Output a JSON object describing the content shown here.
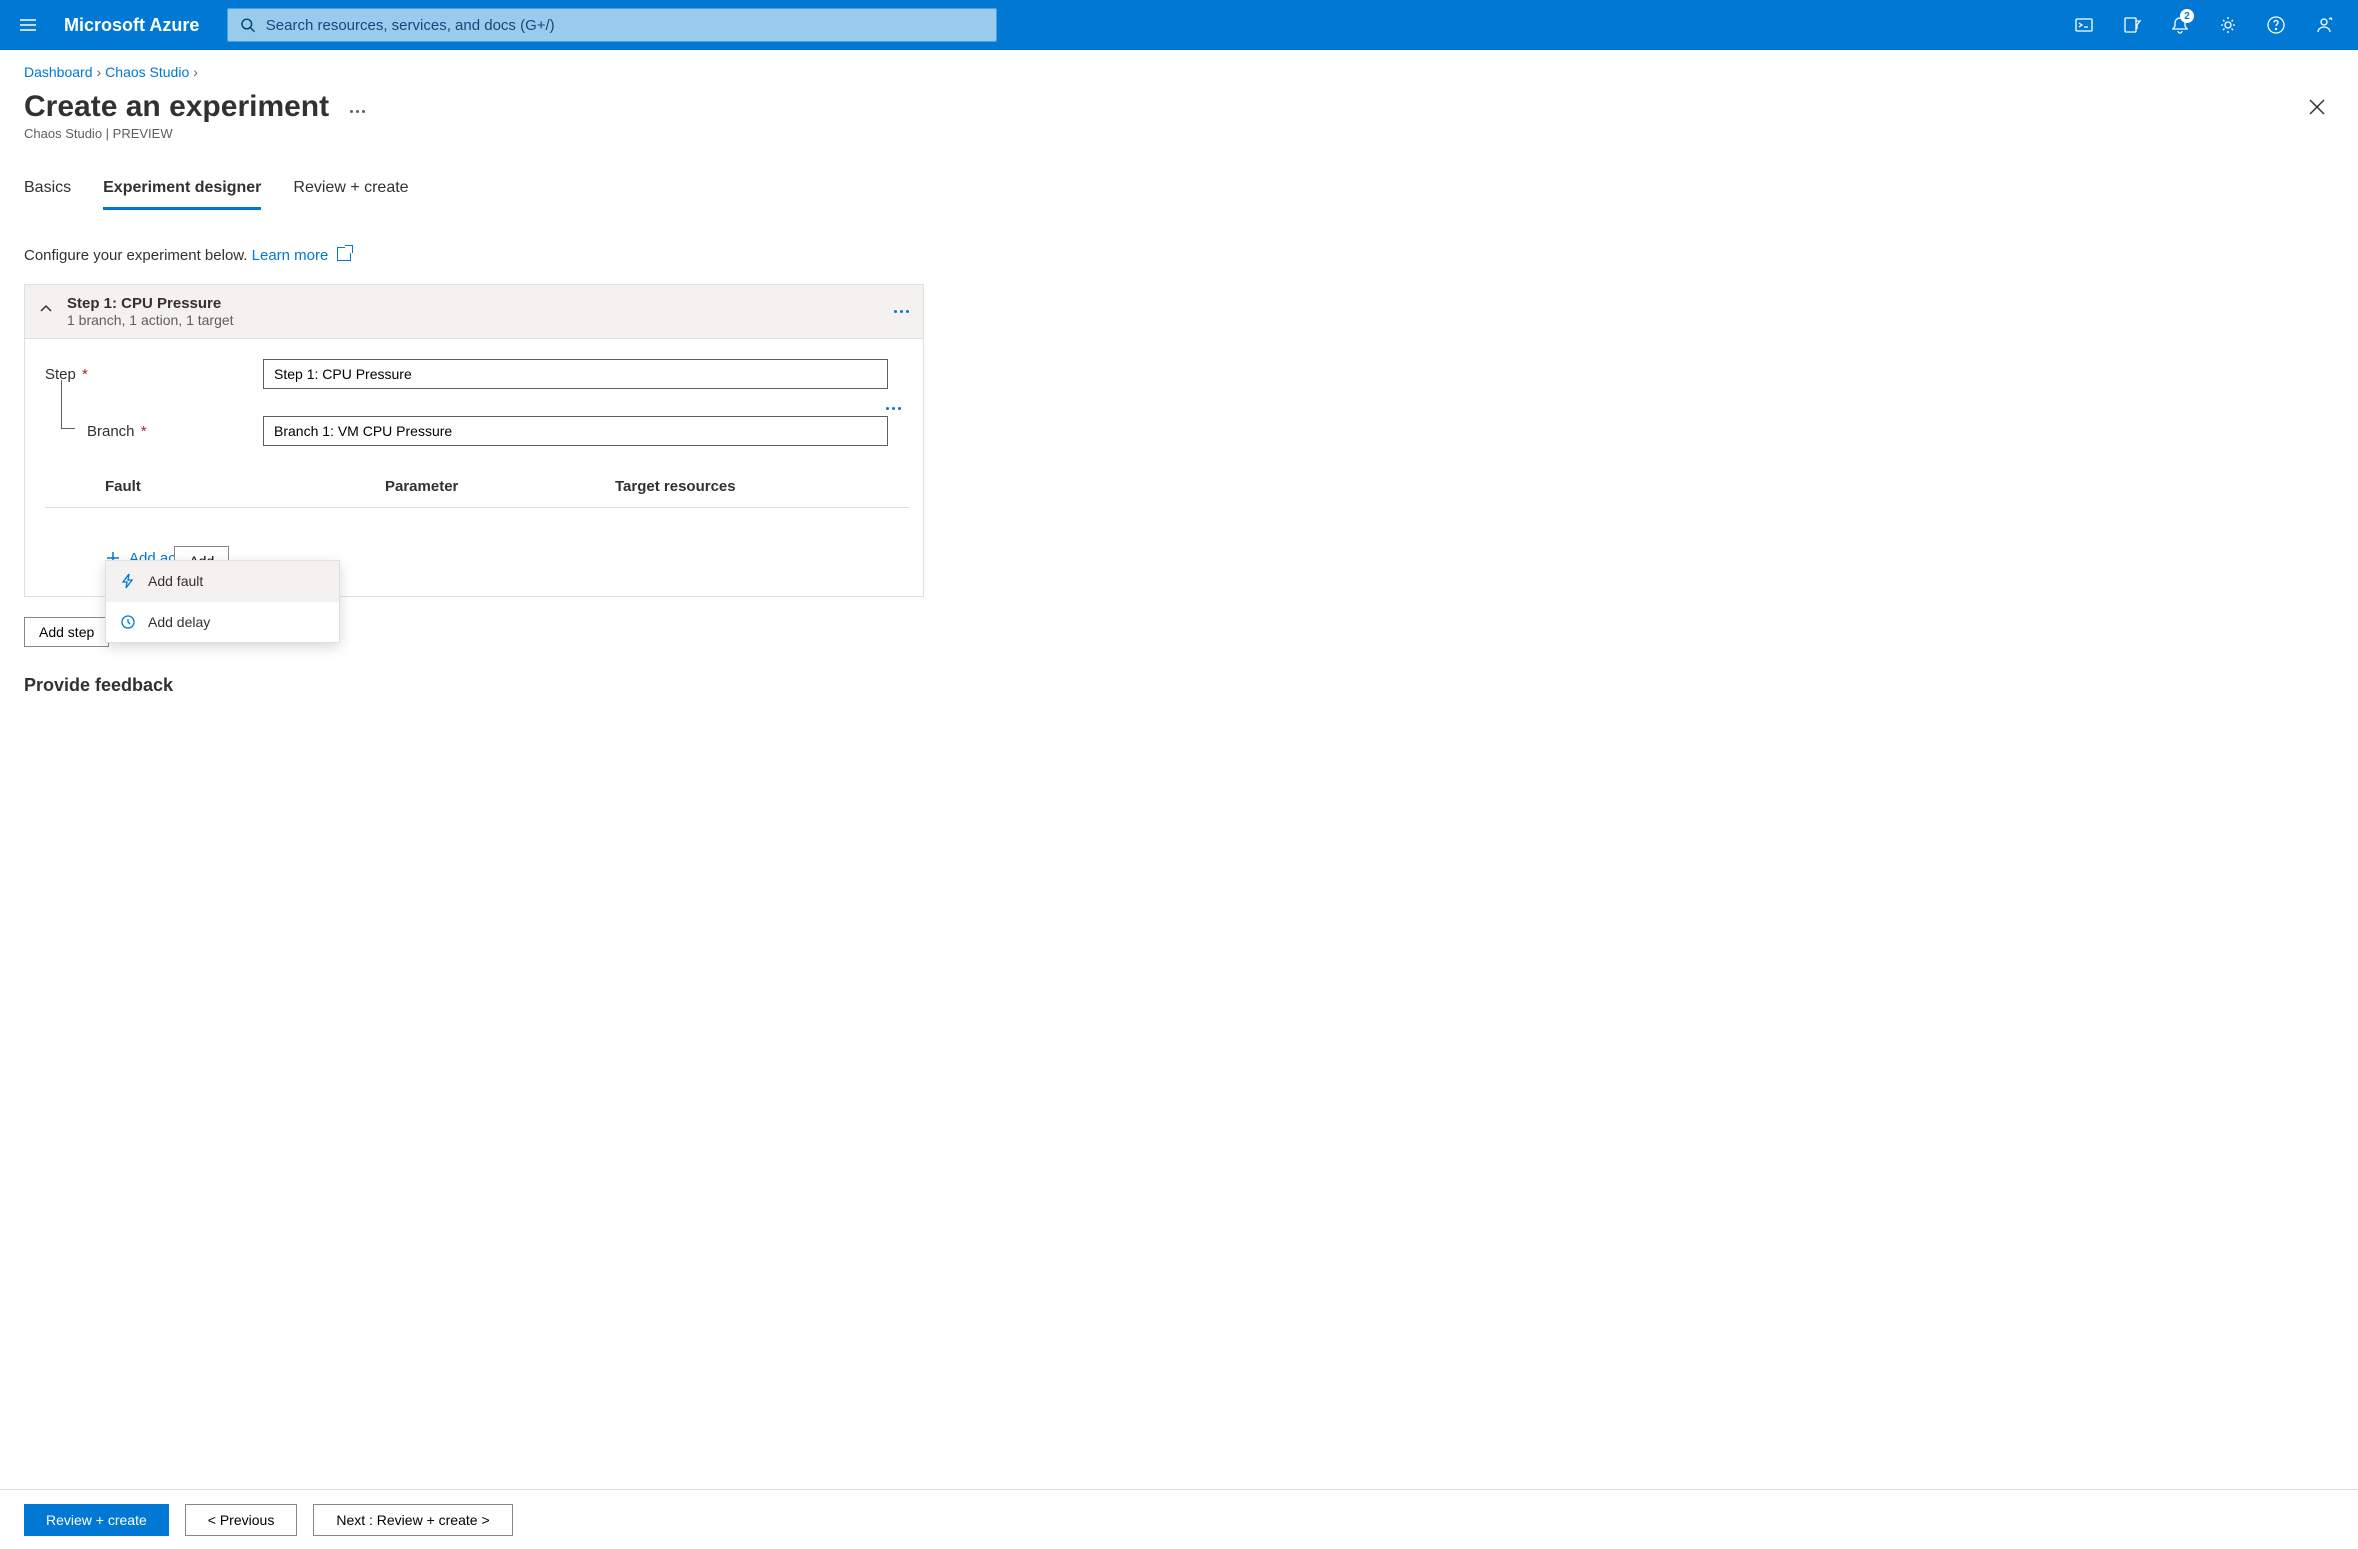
{
  "topbar": {
    "brand": "Microsoft Azure",
    "search_placeholder": "Search resources, services, and docs (G+/)",
    "notification_badge": "2"
  },
  "breadcrumb": {
    "items": [
      "Dashboard",
      "Chaos Studio"
    ]
  },
  "page": {
    "title": "Create an experiment",
    "subtitle": "Chaos Studio | PREVIEW"
  },
  "tabs": {
    "items": [
      "Basics",
      "Experiment designer",
      "Review + create"
    ],
    "active_index": 1
  },
  "designer": {
    "intro": "Configure your experiment below.",
    "learn_more": "Learn more",
    "step": {
      "title": "Step 1: CPU Pressure",
      "summary": "1 branch, 1 action, 1 target",
      "step_label": "Step",
      "step_value": "Step 1: CPU Pressure",
      "branch_label": "Branch",
      "branch_value": "Branch 1: VM CPU Pressure",
      "columns": {
        "fault": "Fault",
        "parameter": "Parameter",
        "target": "Target resources"
      },
      "add_action": "Add action",
      "dropdown": {
        "fault": "Add fault",
        "delay": "Add delay"
      },
      "add_branch": "Add",
      "add_step": "Add step"
    },
    "feedback_heading": "Provide feedback"
  },
  "footer": {
    "primary": "Review + create",
    "prev": "< Previous",
    "next": "Next : Review + create >"
  }
}
